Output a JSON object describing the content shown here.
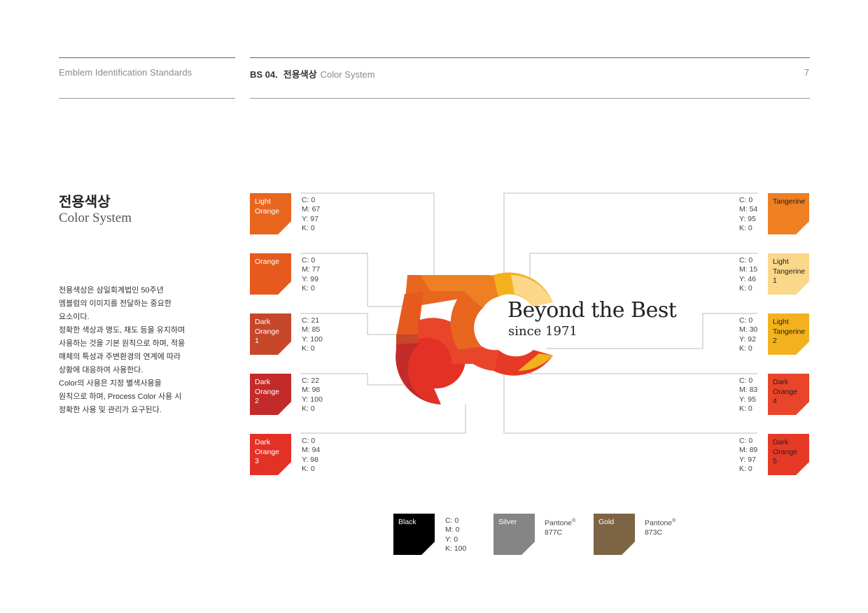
{
  "header": {
    "left_title": "Emblem Identification Standards",
    "section_code": "BS 04.",
    "section_ko": "전용색상",
    "section_en": "Color System",
    "page_number": "7"
  },
  "title": {
    "ko": "전용색상",
    "en": "Color System"
  },
  "description": [
    "전용색상은 삼일회계법인 50주년",
    "엠블럼의 이미지를 전달하는 중요한",
    "요소이다.",
    "정확한 색상과 명도, 채도 등을 유지하며",
    "사용하는 것을 기본 원칙으로 하며, 적용",
    "매체의 특성과 주변환경의 연계에 따라",
    "상황에 대응하여 사용한다.",
    "Color의 사용은 지정 별색사용을",
    "원칙으로 하며, Process Color 사용 시",
    "정확한 사용 및 관리가 요구된다."
  ],
  "left_colors": [
    {
      "name": "Light\nOrange",
      "hex": "#E8661E",
      "c": "C:  0",
      "m": "M: 67",
      "y": "Y:  97",
      "k": "K:  0"
    },
    {
      "name": "Orange",
      "hex": "#E65A1E",
      "c": "C:  0",
      "m": "M: 77",
      "y": "Y:  99",
      "k": "K:  0"
    },
    {
      "name": "Dark\nOrange\n1",
      "hex": "#C6472A",
      "c": "C:  21",
      "m": "M: 85",
      "y": "Y:  100",
      "k": "K:  0"
    },
    {
      "name": "Dark\nOrange\n2",
      "hex": "#C32B2A",
      "c": "C:  22",
      "m": "M: 98",
      "y": "Y:  100",
      "k": "K:  0"
    },
    {
      "name": "Dark\nOrange\n3",
      "hex": "#E33125",
      "c": "C:  0",
      "m": "M: 94",
      "y": "Y:  98",
      "k": "K:  0"
    }
  ],
  "right_colors": [
    {
      "name": "Tangerine",
      "hex": "#EE7F22",
      "c": "C:  0",
      "m": "M: 54",
      "y": "Y:  95",
      "k": "K:  0",
      "text": "dark"
    },
    {
      "name": "Light\nTangerine\n1",
      "hex": "#FBD78A",
      "c": "C:  0",
      "m": "M: 15",
      "y": "Y:  46",
      "k": "K:  0",
      "text": "dark"
    },
    {
      "name": "Light\nTangerine\n2",
      "hex": "#F3B21D",
      "c": "C:  0",
      "m": "M: 30",
      "y": "Y:  92",
      "k": "K:  0",
      "text": "dark"
    },
    {
      "name": "Dark\nOrange\n4",
      "hex": "#E8452A",
      "c": "C:  0",
      "m": "M: 83",
      "y": "Y:  95",
      "k": "K:  0",
      "text": "dark"
    },
    {
      "name": "Dark\nOrange\n5",
      "hex": "#E63A26",
      "c": "C:  0",
      "m": "M: 89",
      "y": "Y:  97",
      "k": "K:  0",
      "text": "dark"
    }
  ],
  "emblem": {
    "number_text": "50",
    "tagline_main": "Beyond the Best",
    "tagline_sub": "since 1971"
  },
  "spot_colors": [
    {
      "name": "Black",
      "hex": "#000000",
      "lines": [
        "C:  0",
        "M: 0",
        "Y:  0",
        "K:  100"
      ]
    },
    {
      "name": "Silver",
      "hex": "#858585",
      "pantone_label": "Pantone",
      "pantone_code": "877C"
    },
    {
      "name": "Gold",
      "hex": "#7D6444",
      "pantone_label": "Pantone",
      "pantone_code": "873C"
    }
  ],
  "registered_mark": "®"
}
